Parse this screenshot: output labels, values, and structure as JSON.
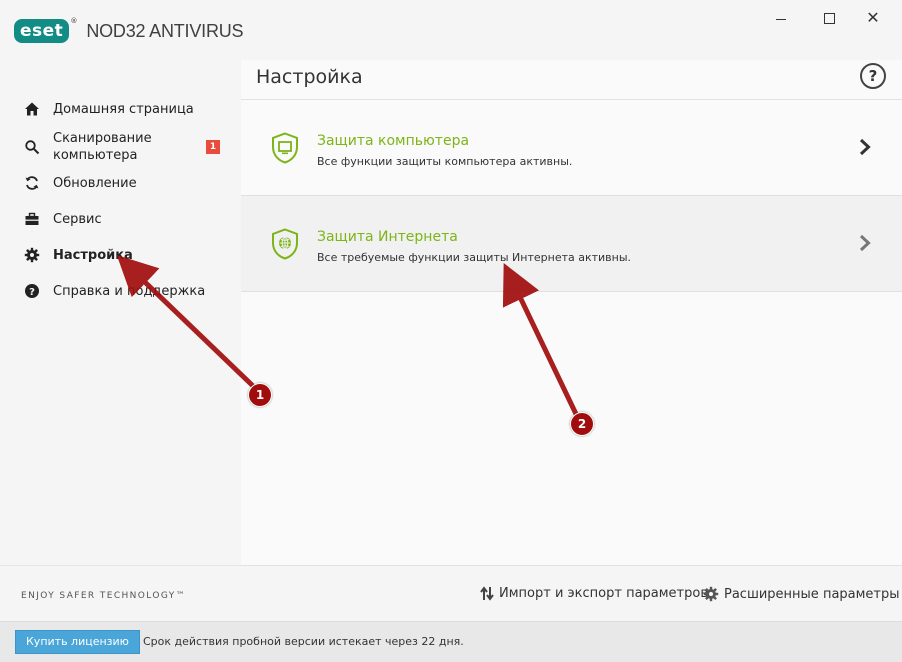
{
  "app": {
    "logo_text": "eset",
    "logo_mark": "®",
    "product_name": "NOD32 ANTIVIRUS",
    "window_controls": {
      "minimize": "minimize-icon",
      "maximize": "maximize-icon",
      "close": "✕"
    },
    "brand_color": "#128c85"
  },
  "sidebar": {
    "items": [
      {
        "label": "Домашняя страница",
        "icon": "home-icon",
        "active": false
      },
      {
        "label": "Сканирование компьютера",
        "icon": "search-icon",
        "active": false,
        "badge": "1"
      },
      {
        "label": "Обновление",
        "icon": "refresh-icon",
        "active": false
      },
      {
        "label": "Сервис",
        "icon": "toolbox-icon",
        "active": false
      },
      {
        "label": "Настройка",
        "icon": "gear-icon",
        "active": true
      },
      {
        "label": "Справка и поддержка",
        "icon": "help-circle-icon",
        "active": false
      }
    ],
    "tagline": "ENJOY SAFER TECHNOLOGY™"
  },
  "main": {
    "title": "Настройка",
    "help_icon": "?",
    "cards": [
      {
        "title": "Защита компьютера",
        "description": "Все функции защиты компьютера активны.",
        "icon": "shield-monitor-icon"
      },
      {
        "title": "Защита Интернета",
        "description": "Все требуемые функции защиты Интернета активны.",
        "icon": "shield-globe-icon"
      }
    ],
    "footer": {
      "import_export": "Импорт и экспорт параметров",
      "advanced": "Расширенные параметры"
    }
  },
  "bottom_bar": {
    "buy_label": "Купить лицензию",
    "trial_text": "Срок действия пробной версии истекает через 22 дня."
  },
  "annotations": {
    "markers": [
      "1",
      "2"
    ],
    "color": "#a10d0d"
  },
  "colors": {
    "accent_green": "#7cb518",
    "badge_red": "#e74c3c",
    "button_blue": "#4aa6d8"
  }
}
